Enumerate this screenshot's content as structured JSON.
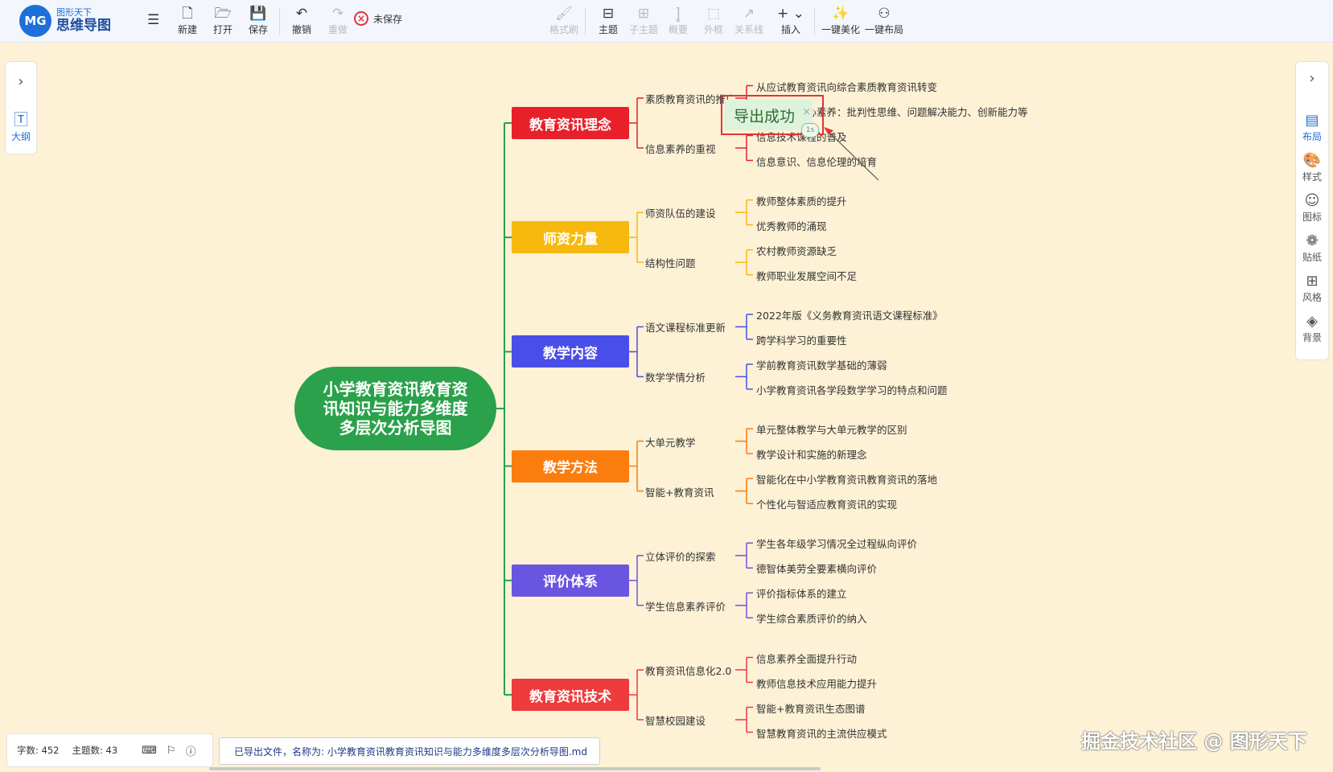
{
  "app": {
    "logo_badge": "MG",
    "logo_sub": "图形天下",
    "logo_main": "思维导图"
  },
  "toolbar": {
    "menu_icon": "hamburger-icon",
    "new": "新建",
    "open": "打开",
    "save": "保存",
    "undo": "撤销",
    "redo": "重做",
    "unsaved": "未保存",
    "format_brush": "格式刷",
    "topic": "主题",
    "subtopic": "子主题",
    "summary": "概要",
    "boundary": "外框",
    "relation": "关系线",
    "insert": "插入",
    "beautify": "一键美化",
    "layout": "一键布局"
  },
  "left_panel": {
    "outline": "大纲"
  },
  "right_panel": {
    "layout": "布局",
    "style": "样式",
    "icon": "图标",
    "sticker": "贴纸",
    "theme": "风格",
    "background": "背景"
  },
  "colors": {
    "root": "#2aa14a",
    "b1": "#e8202a",
    "b2": "#f8b90e",
    "b3": "#4a4ee8",
    "b4": "#fb7d0e",
    "b5": "#6a55e0",
    "b6": "#ee3b3b",
    "connector": "#2aa14a"
  },
  "mindmap": {
    "root": "小学教育资讯教育资\n讯知识与能力多维度\n多层次分析导图",
    "branches": [
      {
        "label": "教育资讯理念",
        "subs": [
          {
            "label": "素质教育资讯的推广",
            "leaves": [
              "从应试教育资讯向综合素质教育资讯转变",
              "培养学生核心素养：批判性思维、问题解决能力、创新能力等"
            ]
          },
          {
            "label": "信息素养的重视",
            "leaves": [
              "信息技术课程的普及",
              "信息意识、信息伦理的培育"
            ]
          }
        ]
      },
      {
        "label": "师资力量",
        "subs": [
          {
            "label": "师资队伍的建设",
            "leaves": [
              "教师整体素质的提升",
              "优秀教师的涌现"
            ]
          },
          {
            "label": "结构性问题",
            "leaves": [
              "农村教师资源缺乏",
              "教师职业发展空间不足"
            ]
          }
        ]
      },
      {
        "label": "教学内容",
        "subs": [
          {
            "label": "语文课程标准更新",
            "leaves": [
              "2022年版《义务教育资讯语文课程标准》",
              "跨学科学习的重要性"
            ]
          },
          {
            "label": "数学学情分析",
            "leaves": [
              "学前教育资讯数学基础的薄弱",
              "小学教育资讯各学段数学学习的特点和问题"
            ]
          }
        ]
      },
      {
        "label": "教学方法",
        "subs": [
          {
            "label": "大单元教学",
            "leaves": [
              "单元整体教学与大单元教学的区别",
              "教学设计和实施的新理念"
            ]
          },
          {
            "label": "智能+教育资讯",
            "leaves": [
              "智能化在中小学教育资讯教育资讯的落地",
              "个性化与智适应教育资讯的实现"
            ]
          }
        ]
      },
      {
        "label": "评价体系",
        "subs": [
          {
            "label": "立体评价的探索",
            "leaves": [
              "学生各年级学习情况全过程纵向评价",
              "德智体美劳全要素横向评价"
            ]
          },
          {
            "label": "学生信息素养评价",
            "leaves": [
              "评价指标体系的建立",
              "学生综合素质评价的纳入"
            ]
          }
        ]
      },
      {
        "label": "教育资讯技术",
        "subs": [
          {
            "label": "教育资讯信息化2.0",
            "leaves": [
              "信息素养全面提升行动",
              "教师信息技术应用能力提升"
            ]
          },
          {
            "label": "智慧校园建设",
            "leaves": [
              "智能+教育资讯生态图谱",
              "智慧教育资讯的主流供应模式"
            ]
          }
        ]
      }
    ]
  },
  "toast": {
    "text": "导出成功",
    "close": "×",
    "timer": "1s"
  },
  "status": {
    "word_count": "字数: 452",
    "topic_count": "主题数: 43"
  },
  "export_message": "已导出文件，名称为: 小学教育资讯教育资讯知识与能力多维度多层次分析导图.md",
  "watermark": "掘金技术社区 @ 图形天下"
}
